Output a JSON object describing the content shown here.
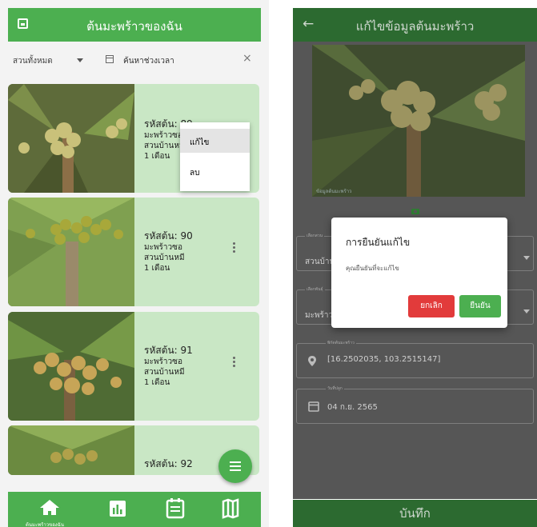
{
  "left_screen": {
    "appbar": {
      "title": "ต้นมะพร้าวของฉัน",
      "icon": "book-icon"
    },
    "filter": {
      "garden_selected": "สวนทั้งหมด",
      "search_placeholder": "ค้นหาช่วงเวลา",
      "clear_symbol": "×"
    },
    "cards": [
      {
        "code": "รหัสต้น: 89",
        "variety": "มะพร้าวซอ",
        "garden": "สวนบ้านหมี",
        "age": "1 เดือน"
      },
      {
        "code": "รหัสต้น: 90",
        "variety": "มะพร้าวซอ",
        "garden": "สวนบ้านหมี",
        "age": "1 เดือน"
      },
      {
        "code": "รหัสต้น: 91",
        "variety": "มะพร้าวซอ",
        "garden": "สวนบ้านหมี",
        "age": "1 เดือน"
      },
      {
        "code": "รหัสต้น: 92",
        "variety": "",
        "garden": "",
        "age": ""
      }
    ],
    "popup_menu": {
      "edit": "แก้ไข",
      "delete": "ลบ"
    },
    "bottom_nav": {
      "items": [
        "home-icon",
        "chart-icon",
        "calendar-icon",
        "map-icon"
      ],
      "home_label": "ต้นมะพร้าวของฉัน"
    }
  },
  "right_screen": {
    "appbar": {
      "title": "แก้ไขข้อมูลต้นมะพร้าว",
      "back_symbol": "←"
    },
    "photo_caption": "ข้อมูลต้นมะพร้าว",
    "fields": {
      "garden_label": "เลือกสวน",
      "garden_value": "สวนบ้าน",
      "variety_label": "เลือกพันธุ์",
      "variety_value": "มะพร้าว",
      "coord_label": "พิกัดต้นมะพร้าว",
      "coord_value": "[16.2502035, 103.2515147]",
      "date_label": "วันที่ปลูก",
      "date_value": "04 ก.ย. 2565"
    },
    "dialog": {
      "title": "การยืนยันแก้ไข",
      "message": "คุณยืนยันที่จะแก้ไข",
      "cancel": "ยกเลิก",
      "confirm": "ยืนยัน"
    },
    "save_button": "บันทึก"
  },
  "colors": {
    "primary": "#4caf50",
    "card_bg": "#c9e7c5",
    "cancel": "#e23b3b"
  }
}
